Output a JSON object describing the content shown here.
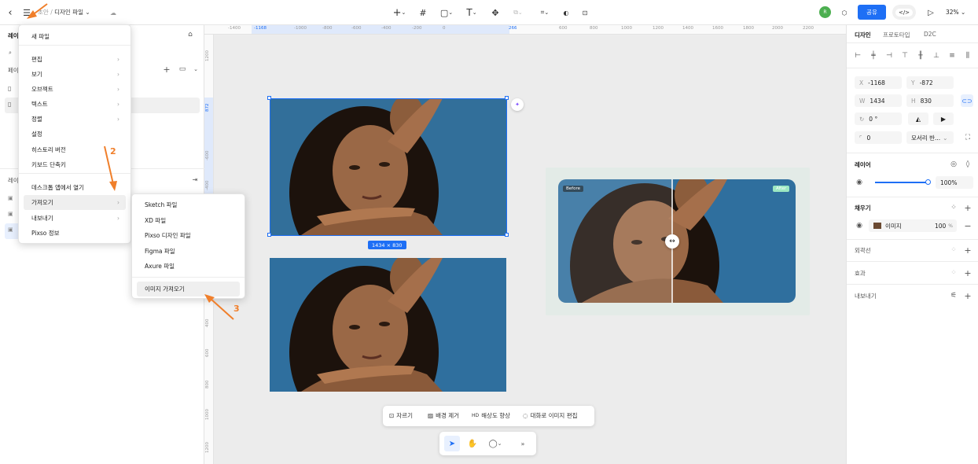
{
  "topbar": {
    "breadcrumb_project": "초안",
    "breadcrumb_sep": "/",
    "file_name": "디자인 파일",
    "share_label": "공유",
    "zoom": "32%"
  },
  "left_panel": {
    "title": "레이",
    "section2": "레이",
    "layer_heading": "페이"
  },
  "main_menu": {
    "items": [
      {
        "label": "새 파일",
        "arrow": ""
      },
      {
        "label": "편집",
        "arrow": "›"
      },
      {
        "label": "보기",
        "arrow": "›"
      },
      {
        "label": "오브젝트",
        "arrow": "›"
      },
      {
        "label": "텍스트",
        "arrow": "›"
      },
      {
        "label": "정렬",
        "arrow": "›"
      },
      {
        "label": "설정",
        "arrow": ""
      },
      {
        "label": "히스토리 버전",
        "arrow": ""
      },
      {
        "label": "키보드 단축키",
        "arrow": ""
      },
      {
        "label": "데스크톱 앱에서 열기",
        "arrow": ""
      },
      {
        "label": "가져오기",
        "arrow": "›"
      },
      {
        "label": "내보내기",
        "arrow": "›"
      },
      {
        "label": "Pixso 정보",
        "arrow": ""
      }
    ]
  },
  "import_submenu": {
    "items": [
      {
        "label": "Sketch 파일"
      },
      {
        "label": "XD 파일"
      },
      {
        "label": "Pixso 디자인 파일"
      },
      {
        "label": "Figma 파일"
      },
      {
        "label": "Axure 파일"
      },
      {
        "label": "이미지 가져오기"
      }
    ]
  },
  "annotations": {
    "step2": "2",
    "step3": "3"
  },
  "ruler": {
    "top_ticks": [
      "-1400",
      "-1168",
      "-1000",
      "-800",
      "-600",
      "-400",
      "-200",
      "0",
      "266",
      "600",
      "800",
      "1000",
      "1200",
      "1400",
      "1600",
      "1800",
      "2000",
      "2200"
    ],
    "left_ticks": [
      "1200",
      "872",
      "-600",
      "-400",
      "-200",
      "0",
      "200",
      "400",
      "600",
      "800",
      "1000",
      "1200"
    ]
  },
  "canvas": {
    "size_badge": "1434 × 830",
    "before_label": "Before",
    "after_label": "After"
  },
  "image_toolbar": {
    "crop": "자르기",
    "remove_bg": "배경 제거",
    "upscale": "해상도 향상",
    "chat_edit": "대화로 이미지 편집"
  },
  "right_panel": {
    "tabs": [
      "디자인",
      "프로토타입",
      "D2C"
    ],
    "x_label": "X",
    "x_value": "-1168",
    "y_label": "Y",
    "y_value": "-872",
    "w_label": "W",
    "w_value": "1434",
    "h_label": "H",
    "h_value": "830",
    "rotation": "0 °",
    "radius": "0",
    "corner_select": "모서리 반...",
    "layer_title": "레이어",
    "opacity": "100%",
    "opacity_fraction": 1.0,
    "fill_title": "채우기",
    "fill_type": "이미지",
    "fill_opacity": "100",
    "fill_unit": "%",
    "stroke_title": "외곽선",
    "effect_title": "효과",
    "export_title": "내보내기"
  },
  "colors": {
    "accent": "#1e6ff5",
    "annotation": "#f07f2b",
    "avatar": "#4caf50",
    "photo_bg": "#2f6f9e"
  }
}
